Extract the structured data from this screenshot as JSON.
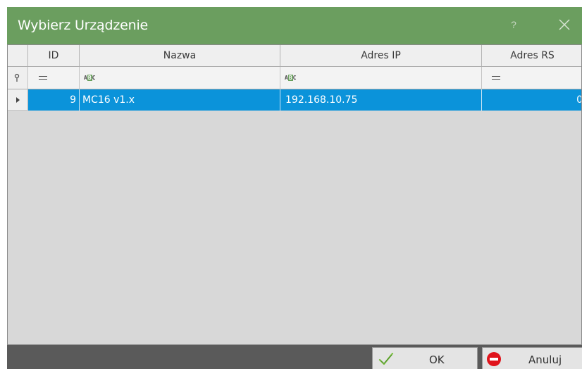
{
  "window": {
    "title": "Wybierz Urządzenie",
    "help_glyph": "?",
    "accent_color": "#6b9e5f"
  },
  "grid": {
    "columns": [
      {
        "label": "ID",
        "filter": "equals"
      },
      {
        "label": "Nazwa",
        "filter": "text"
      },
      {
        "label": "Adres IP",
        "filter": "text"
      },
      {
        "label": "Adres RS",
        "filter": "equals"
      }
    ],
    "rows": [
      {
        "id": "9",
        "nazwa": "MC16 v1.x",
        "adres_ip": "192.168.10.75",
        "adres_rs": "0",
        "selected": true
      }
    ],
    "selection_color": "#0b93da"
  },
  "buttons": {
    "ok_label": "OK",
    "cancel_label": "Anuluj"
  }
}
